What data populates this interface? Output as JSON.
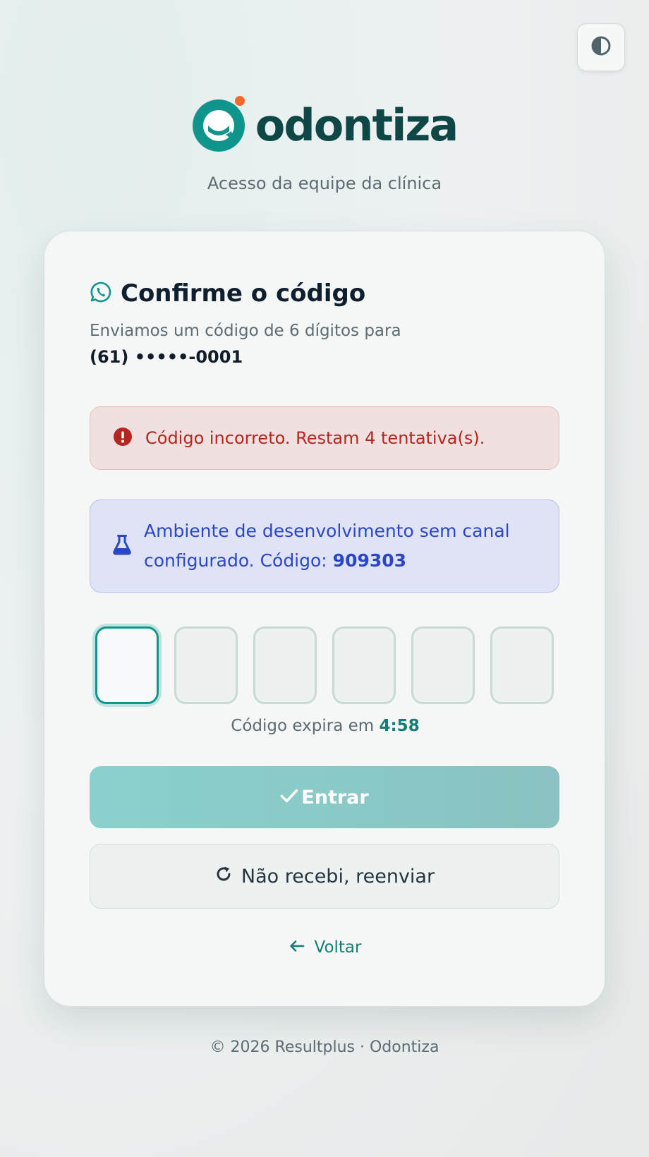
{
  "header": {
    "theme_toggle_icon": "half-circle-contrast-icon",
    "brand_name": "odontiza",
    "tagline": "Acesso da equipe da clínica"
  },
  "card": {
    "title": "Confirme o código",
    "title_icon": "whatsapp-icon",
    "subtitle": "Enviamos um código de 6 dígitos para",
    "phone": "(61) •••••-0001",
    "error_alert": {
      "icon": "exclamation-circle-icon",
      "message": "Código incorreto. Restam 4 tentativa(s)."
    },
    "dev_alert": {
      "icon": "flask-icon",
      "message": "Ambiente de desenvolvimento sem canal configurado. Código: ",
      "code": "909303"
    },
    "otp": {
      "digits": [
        "",
        "",
        "",
        "",
        "",
        ""
      ],
      "active_index": 0
    },
    "expiry": {
      "label": "Código expira em ",
      "time": "4:58"
    },
    "submit_button": {
      "icon": "check-icon",
      "label": "Entrar"
    },
    "resend_button": {
      "icon": "refresh-icon",
      "label": "Não recebi, reenviar"
    },
    "back_link": {
      "icon": "arrow-left-icon",
      "label": "Voltar"
    }
  },
  "footer": {
    "text": "© 2026 Resultplus · Odontiza"
  },
  "colors": {
    "brand_teal": "#10958c",
    "brand_dark": "#0f4747",
    "brand_orange": "#f26a2b",
    "error_text": "#b5261f",
    "info_text": "#2a46c9"
  }
}
